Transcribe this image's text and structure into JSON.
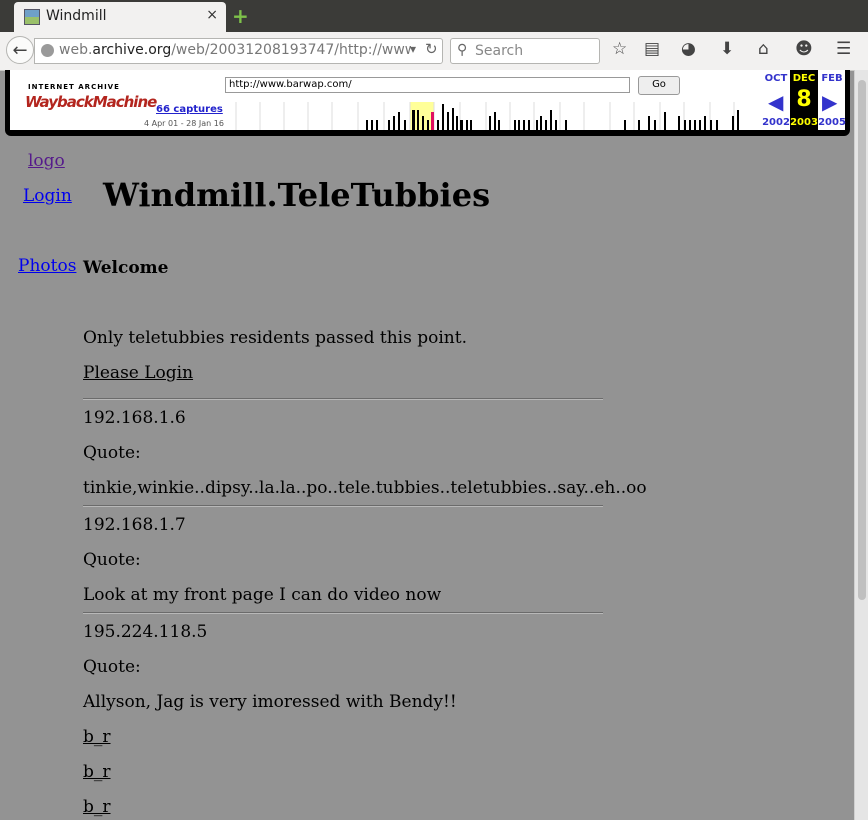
{
  "browser": {
    "tab_title": "Windmill",
    "tab_close": "×",
    "new_tab": "+",
    "url_prefix": "web.",
    "url_domain": "archive.org",
    "url_rest": "/web/20031208193747/http://www.",
    "search_placeholder": "Search"
  },
  "wayback": {
    "logo_top": "INTERNET ARCHIVE",
    "logo_main": "WaybackMachine",
    "url_value": "http://www.barwap.com/",
    "go_label": "Go",
    "captures": "66 captures",
    "range": "4 Apr 01 - 28 Jan 16",
    "prev_month": "OCT",
    "prev_year": "2002",
    "curr_month": "DEC",
    "curr_day": "8",
    "curr_year": "2003",
    "next_month": "FEB",
    "next_year": "2005",
    "prev_arrow": "◀",
    "next_arrow": "▶"
  },
  "page": {
    "logo_link": "logo",
    "login_link": "Login",
    "photos_link": "Photos",
    "title": "Windmill.TeleTubbies",
    "welcome": "Welcome",
    "intro": "Only teletubbies residents passed this point.",
    "please_login": "Please Login",
    "entries": [
      {
        "ip": "192.168.1.6",
        "quote_label": "Quote:",
        "text": "tinkie,winkie..dipsy..la.la..po..tele.tubbies..teletubbies..say..eh..oo"
      },
      {
        "ip": "192.168.1.7",
        "quote_label": "Quote:",
        "text": "Look at my front page I can do video now"
      },
      {
        "ip": "195.224.118.5",
        "quote_label": "Quote:",
        "text": "Allyson, Jag is very imoressed with Bendy!!"
      }
    ],
    "br_links": [
      "b_r",
      "b_r",
      "b_r"
    ]
  }
}
